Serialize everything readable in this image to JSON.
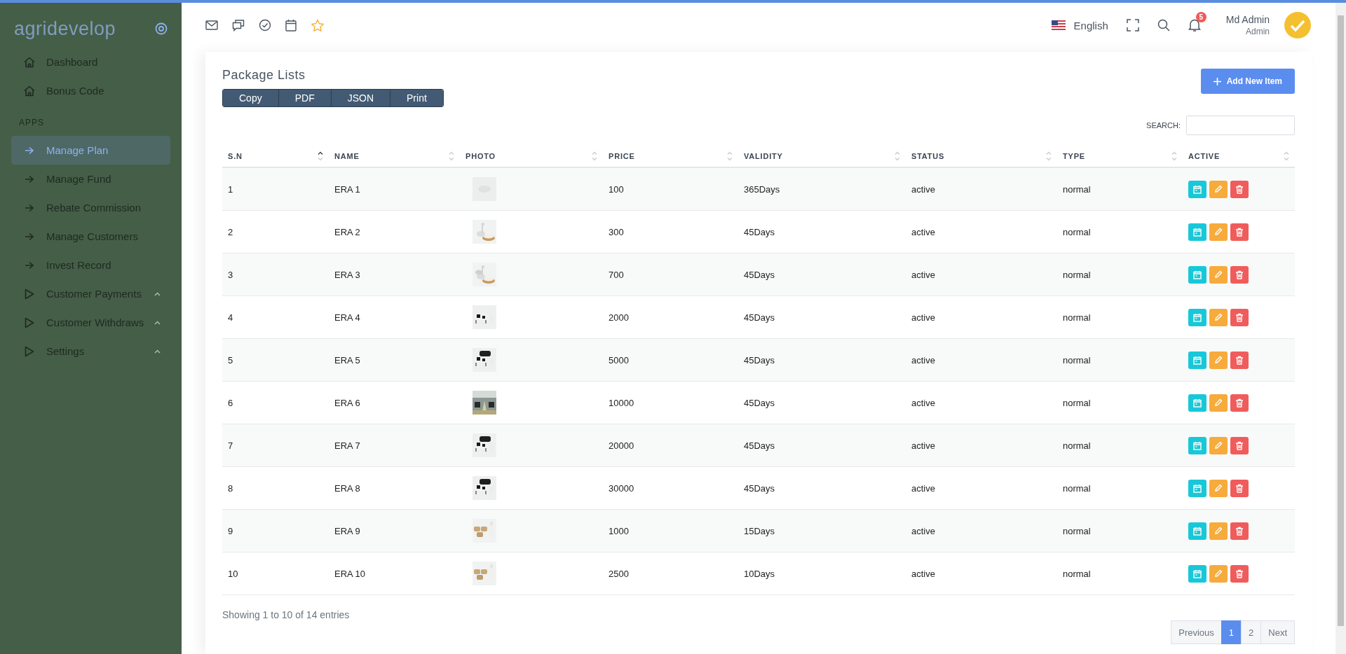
{
  "sidebar": {
    "logo": "agridevelop",
    "items": [
      {
        "label": "Dashboard",
        "kind": "home",
        "selected": false
      },
      {
        "label": "Bonus Code",
        "kind": "home",
        "selected": false
      }
    ],
    "section": "APPS",
    "app_items": [
      {
        "label": "Manage Plan",
        "kind": "link",
        "selected": true
      },
      {
        "label": "Manage Fund",
        "kind": "link",
        "selected": false
      },
      {
        "label": "Rebate Commission",
        "kind": "link",
        "selected": false
      },
      {
        "label": "Manage Customers",
        "kind": "link",
        "selected": false
      },
      {
        "label": "Invest Record",
        "kind": "link",
        "selected": false
      },
      {
        "label": "Customer Payments",
        "kind": "group",
        "selected": false
      },
      {
        "label": "Customer Withdraws",
        "kind": "group",
        "selected": false
      },
      {
        "label": "Settings",
        "kind": "group",
        "selected": false
      }
    ]
  },
  "header": {
    "language": "English",
    "notifications": "5",
    "user_name": "Md Admin",
    "user_role": "Admin"
  },
  "page": {
    "title": "Package Lists",
    "export_buttons": [
      "Copy",
      "PDF",
      "JSON",
      "Print"
    ],
    "add_button": "Add New Item",
    "search_label": "SEARCH:"
  },
  "table": {
    "columns": [
      {
        "label": "S.N",
        "sorted": true
      },
      {
        "label": "NAME",
        "sorted": false
      },
      {
        "label": "PHOTO",
        "sorted": false
      },
      {
        "label": "PRICE",
        "sorted": false
      },
      {
        "label": "VALIDITY",
        "sorted": false
      },
      {
        "label": "STATUS",
        "sorted": false
      },
      {
        "label": "TYPE",
        "sorted": false
      },
      {
        "label": "ACTIVE",
        "sorted": false
      }
    ],
    "rows": [
      {
        "sn": "1",
        "name": "ERA 1",
        "price": "100",
        "validity": "365Days",
        "status": "active",
        "type": "normal"
      },
      {
        "sn": "2",
        "name": "ERA 2",
        "price": "300",
        "validity": "45Days",
        "status": "active",
        "type": "normal"
      },
      {
        "sn": "3",
        "name": "ERA 3",
        "price": "700",
        "validity": "45Days",
        "status": "active",
        "type": "normal"
      },
      {
        "sn": "4",
        "name": "ERA 4",
        "price": "2000",
        "validity": "45Days",
        "status": "active",
        "type": "normal"
      },
      {
        "sn": "5",
        "name": "ERA 5",
        "price": "5000",
        "validity": "45Days",
        "status": "active",
        "type": "normal"
      },
      {
        "sn": "6",
        "name": "ERA 6",
        "price": "10000",
        "validity": "45Days",
        "status": "active",
        "type": "normal"
      },
      {
        "sn": "7",
        "name": "ERA 7",
        "price": "20000",
        "validity": "45Days",
        "status": "active",
        "type": "normal"
      },
      {
        "sn": "8",
        "name": "ERA 8",
        "price": "30000",
        "validity": "45Days",
        "status": "active",
        "type": "normal"
      },
      {
        "sn": "9",
        "name": "ERA 9",
        "price": "1000",
        "validity": "15Days",
        "status": "active",
        "type": "normal"
      },
      {
        "sn": "10",
        "name": "ERA 10",
        "price": "2500",
        "validity": "10Days",
        "status": "active",
        "type": "normal"
      }
    ]
  },
  "footer": {
    "info": "Showing 1 to 10 of 14 entries",
    "pages": [
      {
        "label": "Previous",
        "selected": false
      },
      {
        "label": "1",
        "selected": true
      },
      {
        "label": "2",
        "selected": false
      },
      {
        "label": "Next",
        "selected": false
      }
    ]
  }
}
